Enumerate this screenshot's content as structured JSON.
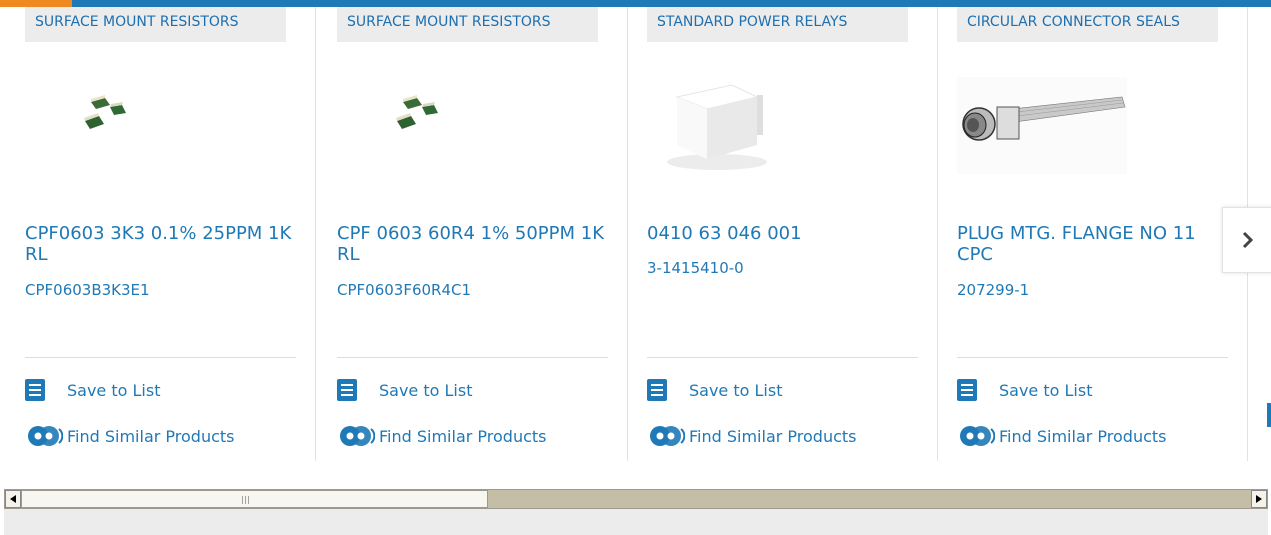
{
  "colors": {
    "brand_blue": "#1f79b6",
    "accent_orange": "#ef8a21",
    "category_bg": "#ececec"
  },
  "products": [
    {
      "category": "SURFACE MOUNT RESISTORS",
      "image": "smd-resistors",
      "title": "CPF0603 3K3 0.1% 25PPM 1K RL",
      "part_number": "CPF0603B3K3E1",
      "save_label": "Save to List",
      "similar_label": "Find Similar Products"
    },
    {
      "category": "SURFACE MOUNT RESISTORS",
      "image": "smd-resistors",
      "title": "CPF 0603 60R4 1% 50PPM 1K RL",
      "part_number": "CPF0603F60R4C1",
      "save_label": "Save to List",
      "similar_label": "Find Similar Products"
    },
    {
      "category": "STANDARD POWER RELAYS",
      "image": "power-relay",
      "title": "0410 63 046 001",
      "part_number": "3-1415410-0",
      "save_label": "Save to List",
      "similar_label": "Find Similar Products"
    },
    {
      "category": "CIRCULAR CONNECTOR SEALS",
      "image": "circular-connector",
      "title": "PLUG MTG. FLANGE NO 11 CPC",
      "part_number": "207299-1",
      "save_label": "Save to List",
      "similar_label": "Find Similar Products"
    }
  ],
  "next_button_icon": "chevron-right-icon"
}
